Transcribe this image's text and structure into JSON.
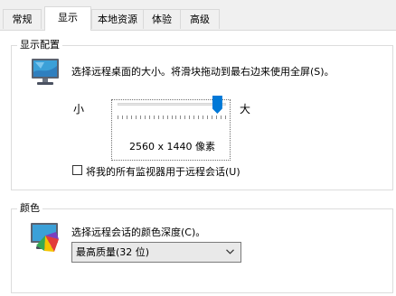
{
  "tabs": [
    {
      "label": "常规",
      "active": false
    },
    {
      "label": "显示",
      "active": true
    },
    {
      "label": "本地资源",
      "active": false
    },
    {
      "label": "体验",
      "active": false
    },
    {
      "label": "高级",
      "active": false
    }
  ],
  "display_config": {
    "title": "显示配置",
    "icon": "monitor-icon",
    "description": "选择远程桌面的大小。将滑块拖动到最右边来使用全屏(S)。",
    "slider": {
      "min_label": "小",
      "max_label": "大",
      "value_fraction": 0.92,
      "resolution_text": "2560 x 1440 像素"
    },
    "all_monitors": {
      "label": "将我的所有监视器用于远程会话(U)",
      "checked": false
    }
  },
  "colors_group": {
    "title": "颜色",
    "icon": "color-palette-monitor-icon",
    "description": "选择远程会话的颜色深度(C)。",
    "color_depth_select": {
      "value": "最高质量(32 位)"
    }
  },
  "theme": {
    "accent": "#0078d7",
    "panel_bg": "#ffffff",
    "window_bg": "#f0f0f0"
  }
}
